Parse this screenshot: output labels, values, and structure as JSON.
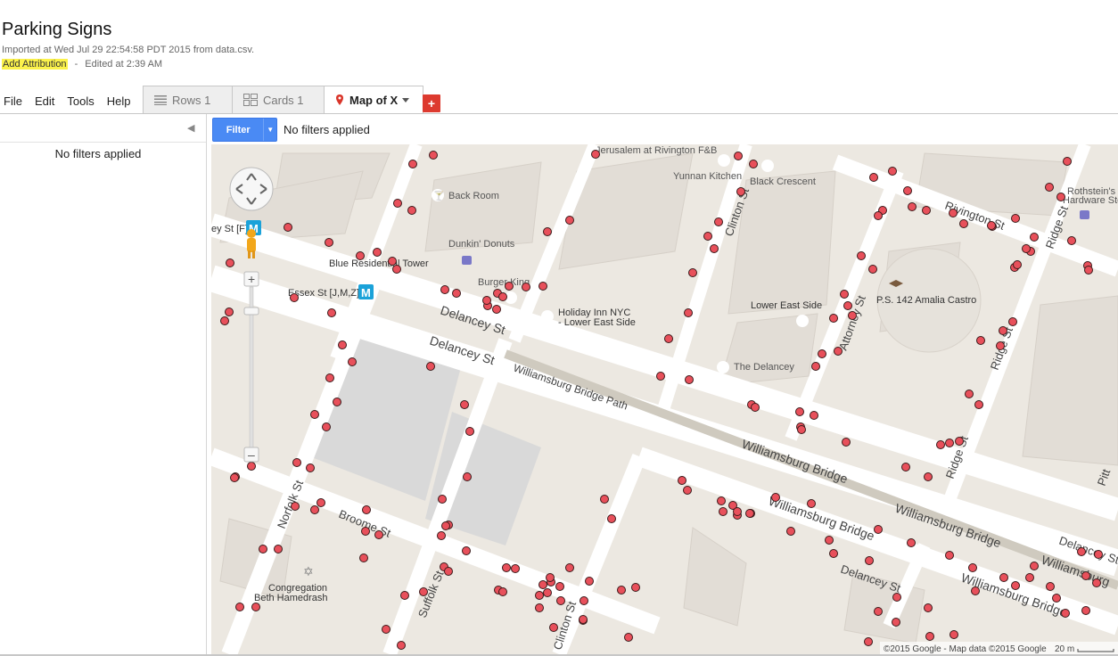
{
  "header": {
    "title": "Parking Signs",
    "subtitle": "Imported at Wed Jul 29 22:54:58 PDT 2015 from data.csv.",
    "attribution": "Add Attribution",
    "separator": "-",
    "edited": "Edited at 2:39 AM"
  },
  "menu": [
    "File",
    "Edit",
    "Tools",
    "Help"
  ],
  "tabs": [
    {
      "label": "Rows 1",
      "icon": "rows-icon"
    },
    {
      "label": "Cards 1",
      "icon": "cards-icon"
    },
    {
      "label": "Map of X",
      "icon": "map-pin-icon",
      "active": true
    }
  ],
  "add_tab": "+",
  "sidebar": {
    "collapse": "◀",
    "no_filters": "No filters applied"
  },
  "filter": {
    "button": "Filter",
    "status": "No filters applied"
  },
  "map": {
    "streets": {
      "delancey_1": "Delancey St",
      "delancey_2": "Delancey St",
      "delancey_3": "Delancey St",
      "delancey_4": "Delancey St",
      "williamsburg_path": "Williamsburg Bridge Path",
      "williamsburg_1": "Williamsburg Bridge",
      "williamsburg_2": "Williamsburg Bridge",
      "williamsburg_3": "Williamsburg Bridge",
      "williamsburg_4": "Williamsburg Bridge",
      "williamsburg_5": "Williamsburg",
      "williamsburg_6": "Williamsburg Bridge",
      "norfolk": "Norfolk St",
      "suffolk": "Suffolk St",
      "clinton_1": "Clinton St",
      "clinton_2": "Clinton St",
      "attorney": "Attorney St",
      "ridge_1": "Ridge St",
      "ridge_2": "Ridge St",
      "ridge_3": "Ridge St",
      "rivington": "Rivington St",
      "broome": "Broome St",
      "pitt": "Pitt"
    },
    "pois": {
      "back_room": "Back Room",
      "dunkin": "Dunkin' Donuts",
      "burger_king": "Burger King",
      "holiday_inn_1": "Holiday Inn NYC",
      "holiday_inn_2": "- Lower East Side",
      "blue_tower": "Blue Residential Tower",
      "yunnan": "Yunnan Kitchen",
      "black_crescent": "Black Crescent",
      "rothstein_1": "Rothstein's",
      "rothstein_2": "Hardware Sto",
      "lower_east_side": "Lower East Side",
      "the_delancey": "The Delancey",
      "ps142": "P.S. 142 Amalia Castro",
      "congregation_1": "Congregation",
      "congregation_2": "Beth Hamedrash",
      "jerusalem": "Jerusalem at Rivington F&B"
    },
    "stations": {
      "essex": "Essex St [J,M,Z]",
      "delancey_f": "ey St [F]",
      "metro_letter": "M"
    },
    "copyright": "©2015 Google - Map data ©2015 Google",
    "scale": "20 m",
    "colors": {
      "marker": "#e8505b",
      "road": "#ffffff",
      "land": "#ece8e1",
      "building": "#e2ddd6",
      "park": "#d9d9d9",
      "metro": "#1ba2d9"
    }
  }
}
